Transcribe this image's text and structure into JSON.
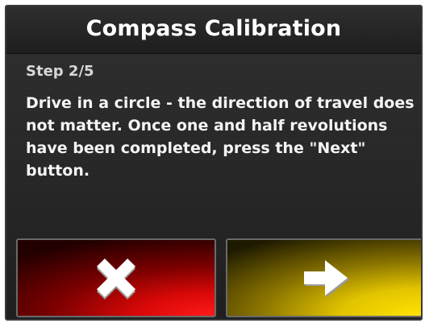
{
  "dialog": {
    "title": "Compass Calibration",
    "step": "Step 2/5",
    "instructions": "Drive in a circle - the direction of travel does not matter. Once one and half revolutions have been completed, press the \"Next\" button."
  },
  "buttons": {
    "cancel": {
      "icon": "close-icon",
      "color": "#e00000"
    },
    "next": {
      "icon": "arrow-right-icon",
      "color": "#f2d600"
    }
  }
}
